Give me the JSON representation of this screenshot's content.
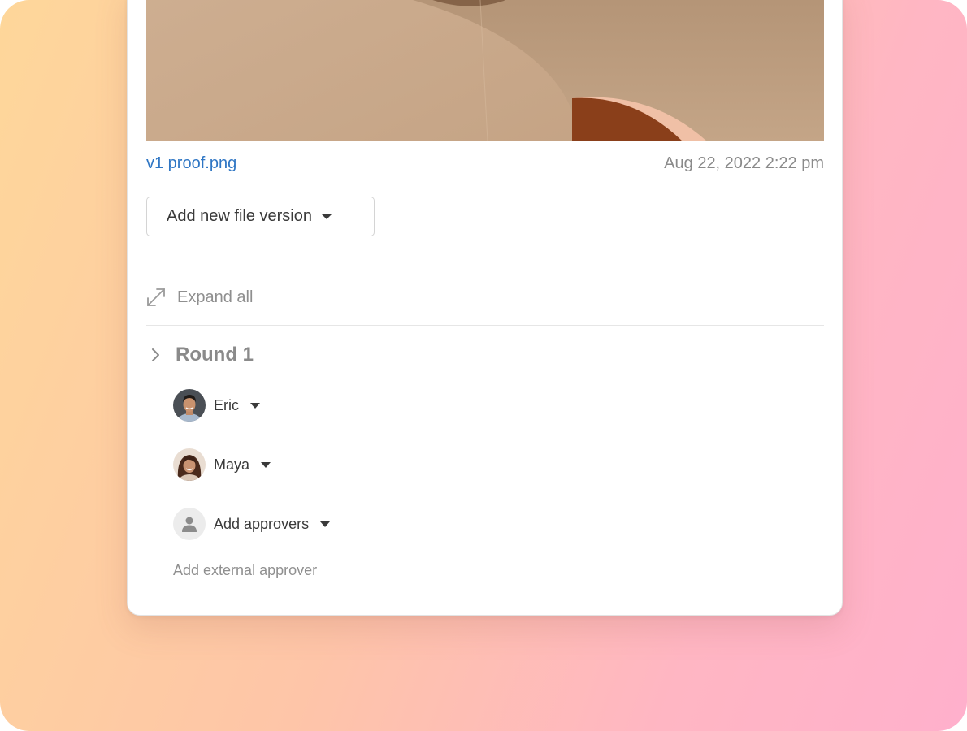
{
  "file": {
    "name": "v1 proof.png",
    "timestamp": "Aug 22, 2022 2:22 pm"
  },
  "version_button": {
    "label": "Add new file version",
    "icon": "caret-down-icon"
  },
  "expand": {
    "label": "Expand all",
    "icon": "expand-arrows-icon"
  },
  "round": {
    "title": "Round 1",
    "icon": "chevron-right-icon"
  },
  "approvers": [
    {
      "name": "Eric",
      "avatar": "eric-avatar"
    },
    {
      "name": "Maya",
      "avatar": "maya-avatar"
    }
  ],
  "add_approvers": {
    "label": "Add approvers",
    "icon": "person-placeholder-icon"
  },
  "external_approver": {
    "label": "Add external approver"
  },
  "colors": {
    "link": "#2f76c4",
    "muted_text": "#8a8a8a",
    "body_text": "#3a3a3a",
    "gradient_start": "#fed79a",
    "gradient_end": "#ffb0cc"
  }
}
